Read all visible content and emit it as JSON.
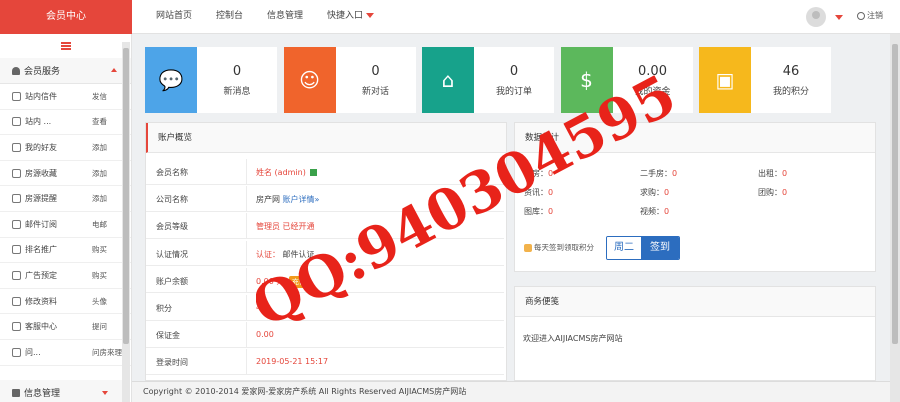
{
  "app": {
    "brand": "会员中心"
  },
  "topnav": {
    "items": [
      "网站首页",
      "控制台",
      "信息管理",
      "快捷入口"
    ],
    "logout": "注销"
  },
  "sidebar": {
    "group1": "会员服务",
    "items": [
      {
        "label": "站内信件",
        "action": "发信",
        "icon": "mail-icon"
      },
      {
        "label": "站内 ...",
        "action": "查看",
        "icon": "chat-icon"
      },
      {
        "label": "我的好友",
        "action": "添加",
        "icon": "user-icon"
      },
      {
        "label": "房源收藏",
        "action": "添加",
        "icon": "star-icon"
      },
      {
        "label": "房源提醒",
        "action": "添加",
        "icon": "bell-icon"
      },
      {
        "label": "邮件订阅",
        "action": "电邮",
        "icon": "envelope-icon"
      },
      {
        "label": "排名推广",
        "action": "购买",
        "icon": "list-icon"
      },
      {
        "label": "广告预定",
        "action": "购买",
        "icon": "monitor-icon"
      },
      {
        "label": "修改资料",
        "action": "头像",
        "icon": "settings-icon"
      },
      {
        "label": "客服中心",
        "action": "提问",
        "icon": "support-icon"
      },
      {
        "label": "问...",
        "action": "问房來理",
        "icon": "question-icon"
      }
    ],
    "group2": "信息管理"
  },
  "cards": [
    {
      "value": "0",
      "label": "新消息",
      "color": "#4da4e8",
      "icon": "message-icon"
    },
    {
      "value": "0",
      "label": "新对话",
      "color": "#f0642c",
      "icon": "chat-bubble-icon"
    },
    {
      "value": "0",
      "label": "我的订单",
      "color": "#17a28b",
      "icon": "store-icon"
    },
    {
      "value": "0.00",
      "label": "我的资金",
      "color": "#5cb85c",
      "icon": "money-bag-icon"
    },
    {
      "value": "46",
      "label": "我的积分",
      "color": "#f6b81c",
      "icon": "gift-icon"
    }
  ],
  "account": {
    "title": "账户概览",
    "rows": [
      {
        "key": "会员名称",
        "value": "姓名 (admin)",
        "extra": ""
      },
      {
        "key": "公司名称",
        "value": "房产网",
        "extra": "账户详情»"
      },
      {
        "key": "会员等级",
        "value": "管理员 已经开通",
        "extra": ""
      },
      {
        "key": "认证情况",
        "value": "认证：",
        "extra": "邮件认证"
      },
      {
        "key": "账户余额",
        "value": "0.00 元",
        "extra": "充值"
      },
      {
        "key": "积分",
        "value": "46",
        "extra": ""
      },
      {
        "key": "保证金",
        "value": "0.00",
        "extra": ""
      },
      {
        "key": "登录时间",
        "value": "2019-05-21 15:17",
        "extra": ""
      }
    ]
  },
  "stats": {
    "title": "数据统计",
    "cells": [
      {
        "label": "新房：",
        "value": "0"
      },
      {
        "label": "二手房：",
        "value": "0"
      },
      {
        "label": "出租：",
        "value": "0"
      },
      {
        "label": "资讯：",
        "value": "0"
      },
      {
        "label": "求购：",
        "value": "0"
      },
      {
        "label": "团购：",
        "value": "0"
      },
      {
        "label": "图库：",
        "value": "0"
      },
      {
        "label": "视频：",
        "value": "0"
      }
    ],
    "sign_hint": "每天签到领取积分",
    "weekday": "周二",
    "sign_label": "签到"
  },
  "notice": {
    "title": "商务便笺",
    "content": "欢迎进入AIJIACMS房产网站"
  },
  "footer": {
    "text": "Copyright © 2010-2014 爱家网-爱家房产系统 All Rights Reserved AIJIACMS房产网站"
  },
  "watermark": {
    "text": "QQ:940304595"
  }
}
